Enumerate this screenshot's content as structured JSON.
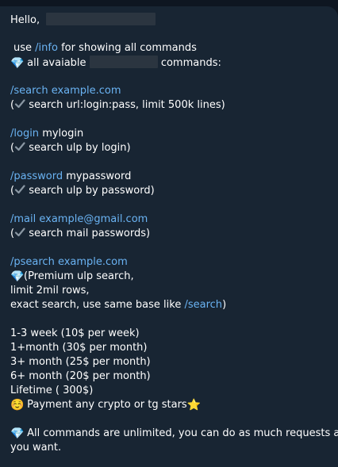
{
  "message": {
    "greeting": "Hello,",
    "info_prefix": "use",
    "info_command": "/info",
    "info_suffix": "for showing all commands",
    "all_available_prefix": "all avaiable",
    "all_available_suffix": "commands:",
    "search": {
      "command": "/search example.com",
      "open": "(",
      "desc": "search url:login:pass, limit 500k lines)"
    },
    "login": {
      "command": "/login",
      "arg": "mylogin",
      "open": "(",
      "desc": "search ulp by login)"
    },
    "password": {
      "command": "/password",
      "arg": "mypassword",
      "open": "(",
      "desc": "search ulp by password)"
    },
    "mail": {
      "command": "/mail example@gmail.com",
      "open": "(",
      "desc": "search mail passwords)"
    },
    "psearch": {
      "command": "/psearch example.com",
      "line1": "(Premium ulp search,",
      "line2": "limit 2mil rows,",
      "line3_prefix": "exact search, use same base like",
      "line3_command": "/search",
      "line3_suffix": ")"
    },
    "pricing": [
      "1-3 week (10$ per week)",
      "1+month (30$ per month)",
      "3+ month (25$ per month)",
      "6+ month (20$ per month)",
      "Lifetime ( 300$)"
    ],
    "payment": "Payment any crypto or tg stars",
    "footer_line1": "All commands are unlimited, you can do as much requests as",
    "footer_line2": "you want."
  },
  "icons": {
    "diamond": "💎",
    "check": "✔️",
    "smile": "☺️",
    "star": "⭐"
  },
  "colors": {
    "background": "#0e1621",
    "bubble": "#182533",
    "link": "#6ab3f3",
    "text": "#ffffff"
  }
}
